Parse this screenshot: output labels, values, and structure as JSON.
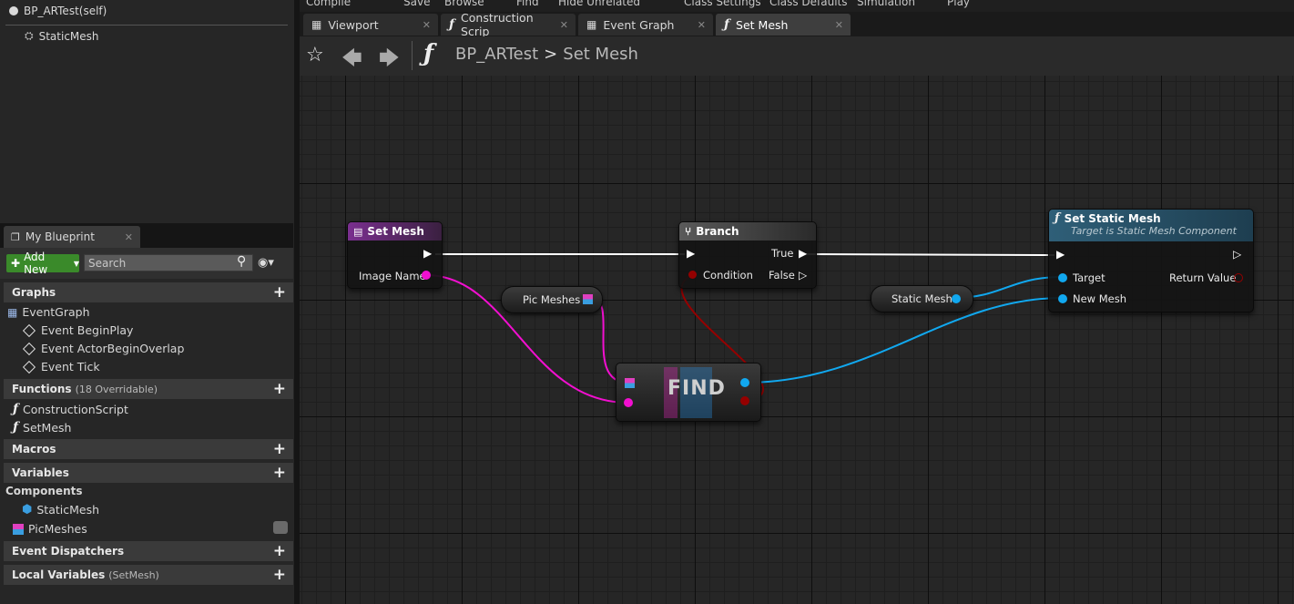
{
  "components": {
    "root": "BP_ARTest(self)",
    "child": "StaticMesh"
  },
  "top_menu": [
    "Compile",
    "Save",
    "Browse",
    "Find",
    "Hide Unrelated",
    "Class Settings",
    "Class Defaults",
    "Simulation",
    "Play"
  ],
  "tabs": [
    {
      "label": "Viewport",
      "icon": "viewport-icon"
    },
    {
      "label": "Construction Scrip",
      "icon": "function-icon"
    },
    {
      "label": "Event Graph",
      "icon": "event-graph-icon"
    },
    {
      "label": "Set Mesh",
      "icon": "function-icon"
    }
  ],
  "breadcrumb": {
    "root": "BP_ARTest",
    "current": "Set Mesh",
    "separator": ">"
  },
  "my_blueprint": {
    "tab_label": "My Blueprint",
    "add_new": "Add New",
    "search_placeholder": "Search",
    "graphs_label": "Graphs",
    "event_graph": "EventGraph",
    "events": [
      "Event BeginPlay",
      "Event ActorBeginOverlap",
      "Event Tick"
    ],
    "functions_label": "Functions",
    "functions_sub": "(18 Overridable)",
    "functions": [
      "ConstructionScript",
      "SetMesh"
    ],
    "macros_label": "Macros",
    "variables_label": "Variables",
    "components_label": "Components",
    "var_components": [
      "StaticMesh"
    ],
    "var_other": [
      "PicMeshes"
    ],
    "dispatchers_label": "Event Dispatchers",
    "local_vars_label": "Local Variables",
    "local_vars_sub": "(SetMesh)"
  },
  "graph": {
    "entry_node": {
      "title": "Set Mesh",
      "pin": "Image Name",
      "color": "#7a2f8f"
    },
    "branch_node": {
      "title": "Branch",
      "condition": "Condition",
      "true": "True",
      "false": "False"
    },
    "pic_meshes": "Pic Meshes",
    "find_node": "FIND",
    "static_mesh": "Static Mesh",
    "set_static_mesh": {
      "title": "Set Static Mesh",
      "subtitle": "Target is Static Mesh Component",
      "target": "Target",
      "new_mesh": "New Mesh",
      "return_value": "Return Value",
      "color": "#2f5f78"
    },
    "colors": {
      "string_pin": "#f20fd0",
      "object_pin": "#11a8ef",
      "bool_pin": "#950000",
      "exec_wire": "#ffffff"
    }
  }
}
